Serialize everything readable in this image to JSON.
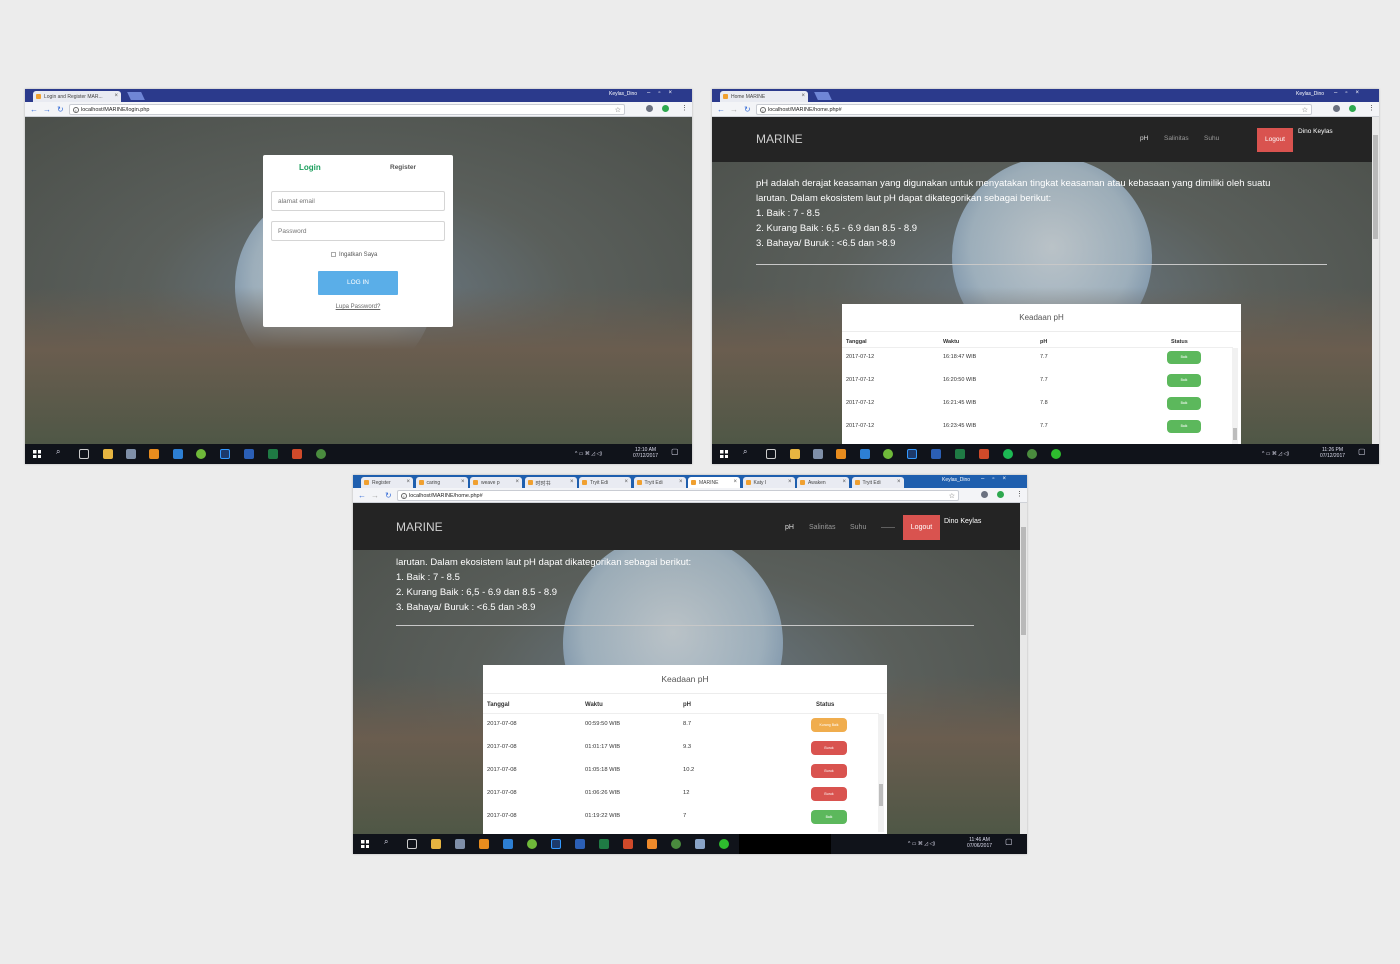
{
  "shots": [
    {
      "user": "Keylas_Dino",
      "tab": "Login and Register MAR...",
      "url": "localhost/MARINE/login.php",
      "login": {
        "tab_login": "Login",
        "tab_register": "Register",
        "email_placeholder": "alamat email",
        "password_placeholder": "Password",
        "remember": "Ingatkan Saya",
        "button": "LOG IN",
        "forgot": "Lupa Password?"
      },
      "clock": {
        "time": "12:10 AM",
        "date": "07/12/2017"
      }
    },
    {
      "user": "Keylas_Dino",
      "tab": "Home MARINE",
      "url": "localhost/MARINE/home.php#",
      "clock": {
        "time": "11:26 PM",
        "date": "07/12/2017"
      }
    },
    {
      "user": "Keylas_Dino",
      "tabs": [
        "Register",
        "caring",
        "weave p",
        "时时书",
        "Tryit Edi",
        "Tryit Edi",
        "MARINE",
        "Katy I",
        "Awaken",
        "Tryit Edi"
      ],
      "url": "localhost/MARINE/home.php#",
      "clock": {
        "time": "11:46 AM",
        "date": "07/06/2017"
      }
    }
  ],
  "home": {
    "brand": "MARINE",
    "nav": [
      "pH",
      "Salinitas",
      "Suhu"
    ],
    "nav_extra": "——",
    "logout": "Logout",
    "user": "Dino Keylas",
    "desc_lines": [
      "pH adalah derajat keasaman yang digunakan untuk menyatakan tingkat keasaman atau kebasaan yang dimiliki oleh suatu",
      "larutan. Dalam ekosistem laut pH dapat dikategorikan sebagai berikut:",
      "1. Baik : 7 - 8.5",
      "2. Kurang Baik : 6,5 - 6.9 dan 8.5 - 8.9",
      "3. Bahaya/ Buruk : <6.5 dan >8.9"
    ],
    "panel_title": "Keadaan pH",
    "columns": [
      "Tanggal",
      "Waktu",
      "pH",
      "Status"
    ]
  },
  "table1": [
    {
      "tanggal": "2017-07-12",
      "waktu": "16:18:47 WIB",
      "ph": "7.7",
      "status": "Baik"
    },
    {
      "tanggal": "2017-07-12",
      "waktu": "16:20:50 WIB",
      "ph": "7.7",
      "status": "Baik"
    },
    {
      "tanggal": "2017-07-12",
      "waktu": "16:21:45 WIB",
      "ph": "7.8",
      "status": "Baik"
    },
    {
      "tanggal": "2017-07-12",
      "waktu": "16:23:45 WIB",
      "ph": "7.7",
      "status": "Baik"
    }
  ],
  "table2": [
    {
      "tanggal": "2017-07-08",
      "waktu": "00:59:50 WIB",
      "ph": "8.7",
      "status": "Kurang Baik"
    },
    {
      "tanggal": "2017-07-08",
      "waktu": "01:01:17 WIB",
      "ph": "9.3",
      "status": "Buruk"
    },
    {
      "tanggal": "2017-07-08",
      "waktu": "01:05:18 WIB",
      "ph": "10.2",
      "status": "Buruk"
    },
    {
      "tanggal": "2017-07-08",
      "waktu": "01:06:26 WIB",
      "ph": "12",
      "status": "Buruk"
    },
    {
      "tanggal": "2017-07-08",
      "waktu": "01:19:22 WIB",
      "ph": "7",
      "status": "Baik"
    }
  ],
  "status_colors": {
    "Baik": "#5cb85c",
    "Kurang Baik": "#f0ad4e",
    "Buruk": "#d9534f"
  },
  "accent": "#1a9e5b"
}
